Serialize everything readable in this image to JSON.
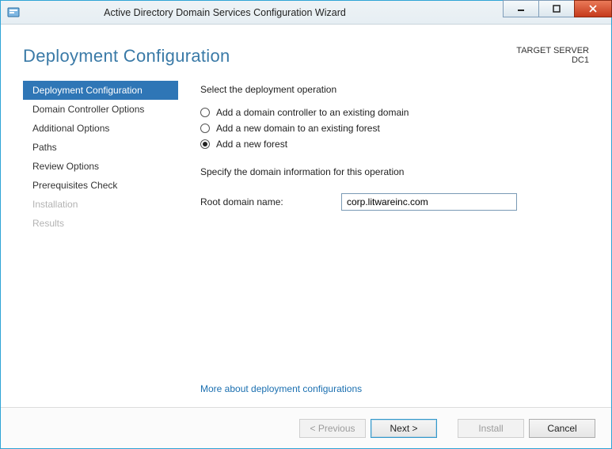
{
  "window": {
    "title": "Active Directory Domain Services Configuration Wizard"
  },
  "header": {
    "page_title": "Deployment Configuration",
    "target_label": "TARGET SERVER",
    "target_value": "DC1"
  },
  "nav": {
    "items": [
      {
        "label": "Deployment Configuration",
        "state": "selected"
      },
      {
        "label": "Domain Controller Options",
        "state": "normal"
      },
      {
        "label": "Additional Options",
        "state": "normal"
      },
      {
        "label": "Paths",
        "state": "normal"
      },
      {
        "label": "Review Options",
        "state": "normal"
      },
      {
        "label": "Prerequisites Check",
        "state": "normal"
      },
      {
        "label": "Installation",
        "state": "disabled"
      },
      {
        "label": "Results",
        "state": "disabled"
      }
    ]
  },
  "pane": {
    "section1_label": "Select the deployment operation",
    "radios": [
      {
        "label": "Add a domain controller to an existing domain",
        "checked": false
      },
      {
        "label": "Add a new domain to an existing forest",
        "checked": false
      },
      {
        "label": "Add a new forest",
        "checked": true
      }
    ],
    "section2_label": "Specify the domain information for this operation",
    "root_domain_label": "Root domain name:",
    "root_domain_value": "corp.litwareinc.com",
    "help_link": "More about deployment configurations"
  },
  "footer": {
    "previous": "< Previous",
    "next": "Next >",
    "install": "Install",
    "cancel": "Cancel"
  }
}
